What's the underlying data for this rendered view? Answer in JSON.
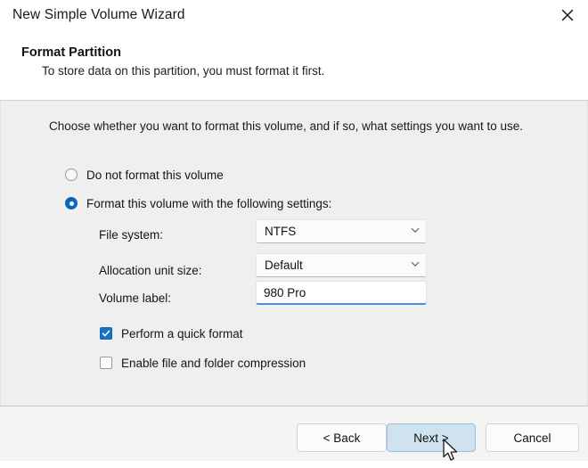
{
  "window": {
    "title": "New Simple Volume Wizard",
    "close_icon": "close-icon"
  },
  "header": {
    "title": "Format Partition",
    "subtitle": "To store data on this partition, you must format it first."
  },
  "body": {
    "intro": "Choose whether you want to format this volume, and if so, what settings you want to use.",
    "radios": [
      {
        "label": "Do not format this volume",
        "selected": false
      },
      {
        "label": "Format this volume with the following settings:",
        "selected": true
      }
    ],
    "fields": [
      {
        "label": "File system:",
        "value": "NTFS",
        "type": "combobox",
        "icon": "chevron-down-icon"
      },
      {
        "label": "Allocation unit size:",
        "value": "Default",
        "type": "combobox",
        "icon": "chevron-down-icon"
      },
      {
        "label": "Volume label:",
        "value": "980 Pro",
        "type": "textbox",
        "focused": true
      }
    ],
    "checkboxes": [
      {
        "label": "Perform a quick format",
        "checked": true,
        "icon": "checkmark-icon"
      },
      {
        "label": "Enable file and folder compression",
        "checked": false
      }
    ]
  },
  "footer": {
    "buttons": [
      {
        "label": "< Back",
        "state": "normal"
      },
      {
        "label": "Next >",
        "state": "hover"
      },
      {
        "label": "Cancel",
        "state": "normal"
      }
    ]
  },
  "pointer": {
    "icon": "arrow-cursor"
  },
  "colors": {
    "accent_blue": "#0a67c0",
    "checkbox_blue": "#1971c2",
    "focus_underline": "#4c8ed4",
    "hover_button_bg": "#cfe2f0",
    "panel_bg": "#efefef",
    "footer_bg": "#f4f4f4"
  }
}
